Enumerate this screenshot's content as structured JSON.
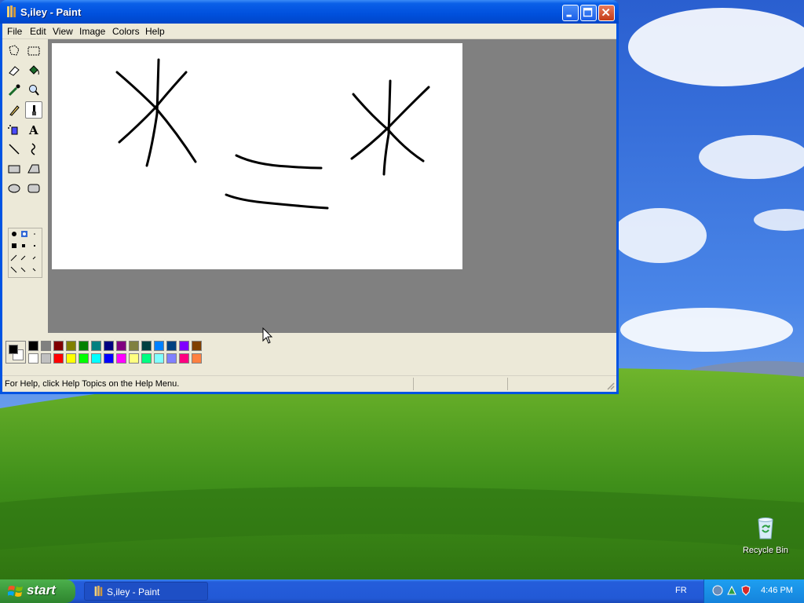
{
  "window": {
    "title": "S,iley - Paint",
    "menu": [
      "File",
      "Edit",
      "View",
      "Image",
      "Colors",
      "Help"
    ]
  },
  "statusbar": {
    "text": "For Help, click Help Topics on the Help Menu."
  },
  "palette": {
    "foreground": "#000000",
    "background": "#ffffff",
    "row1": [
      "#000000",
      "#808080",
      "#800000",
      "#808000",
      "#008000",
      "#008080",
      "#000080",
      "#800080",
      "#808040",
      "#004040",
      "#0080ff",
      "#004080",
      "#8000ff",
      "#804000"
    ],
    "row2": [
      "#ffffff",
      "#c0c0c0",
      "#ff0000",
      "#ffff00",
      "#00ff00",
      "#00ffff",
      "#0000ff",
      "#ff00ff",
      "#ffff80",
      "#00ff80",
      "#80ffff",
      "#8080ff",
      "#ff0080",
      "#ff8040"
    ]
  },
  "tools": [
    "free-form-select",
    "select",
    "eraser",
    "fill",
    "pick-color",
    "magnifier",
    "pencil",
    "brush",
    "airbrush",
    "text",
    "line",
    "curve",
    "rectangle",
    "polygon",
    "ellipse",
    "rounded-rectangle"
  ],
  "active_tool": "brush",
  "desktop": {
    "recycle_bin_label": "Recycle Bin"
  },
  "taskbar": {
    "start_label": "start",
    "task_label": "S,iley - Paint",
    "language": "FR",
    "clock": "4:46 PM"
  }
}
